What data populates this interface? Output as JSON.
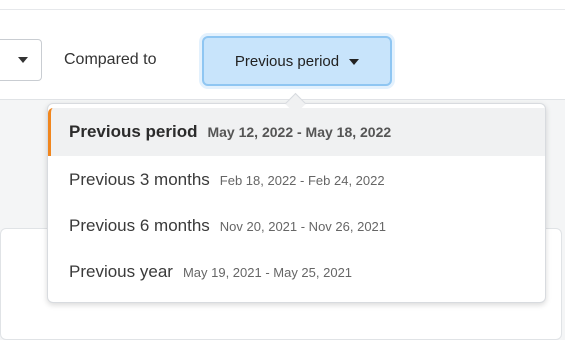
{
  "toolbar": {
    "compared_label": "Compared to",
    "period_button_label": "Previous period"
  },
  "dropdown": {
    "options": [
      {
        "label": "Previous period",
        "range": "May 12, 2022 - May 18, 2022",
        "selected": true
      },
      {
        "label": "Previous 3 months",
        "range": "Feb 18, 2022 - Feb 24, 2022",
        "selected": false
      },
      {
        "label": "Previous 6 months",
        "range": "Nov 20, 2021 - Nov 26, 2021",
        "selected": false
      },
      {
        "label": "Previous year",
        "range": "May 19, 2021 - May 25, 2021",
        "selected": false
      }
    ]
  },
  "colors": {
    "selected_accent": "#f0861e",
    "button_background": "#c8e4fb",
    "button_border": "#8fc6f2"
  },
  "icons": [
    "chevron-down-icon"
  ]
}
